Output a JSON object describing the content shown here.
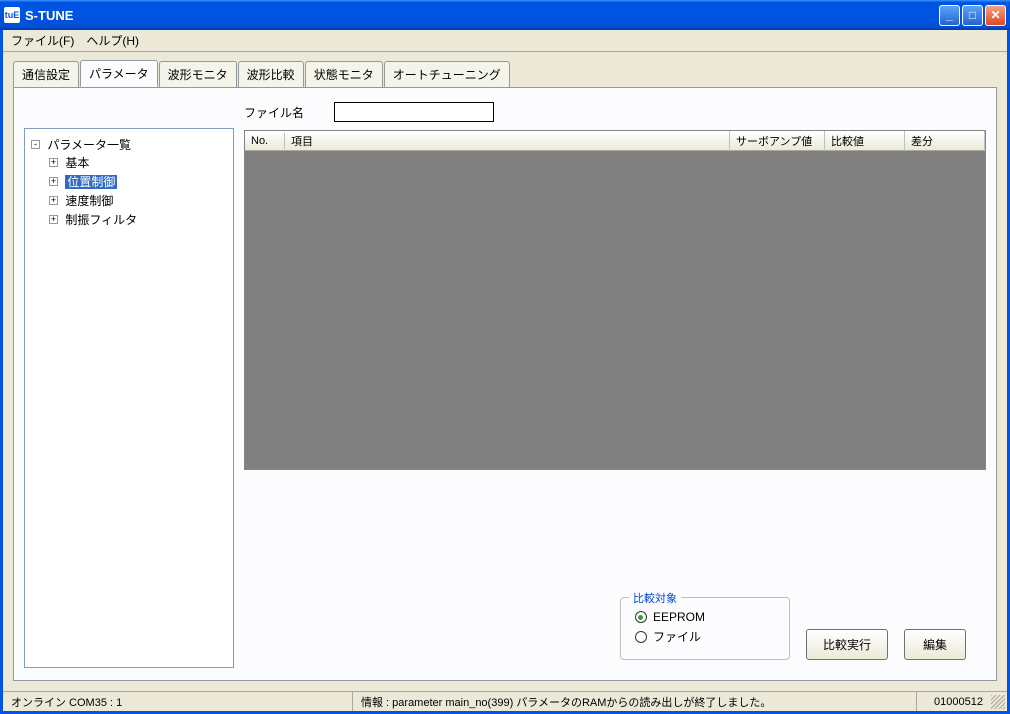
{
  "window": {
    "title": "S-TUNE",
    "icon_text": "tuE"
  },
  "menu": {
    "file": "ファイル(F)",
    "help": "ヘルプ(H)"
  },
  "tabs": [
    {
      "label": "通信設定",
      "active": false
    },
    {
      "label": "パラメータ",
      "active": true
    },
    {
      "label": "波形モニタ",
      "active": false
    },
    {
      "label": "波形比較",
      "active": false
    },
    {
      "label": "状態モニタ",
      "active": false
    },
    {
      "label": "オートチューニング",
      "active": false
    }
  ],
  "tree": {
    "root": "パラメータ一覧",
    "children": [
      {
        "label": "基本",
        "selected": false
      },
      {
        "label": "位置制御",
        "selected": true
      },
      {
        "label": "速度制御",
        "selected": false
      },
      {
        "label": "制振フィルタ",
        "selected": false
      }
    ]
  },
  "file_section": {
    "label": "ファイル名",
    "value": ""
  },
  "table_headers": {
    "no": "No.",
    "item": "項目",
    "amp": "サーボアンプ値",
    "cmp": "比較値",
    "diff": "差分"
  },
  "compare_group": {
    "title": "比較対象",
    "options": {
      "eeprom": "EEPROM",
      "file": "ファイル"
    },
    "selected": "eeprom"
  },
  "buttons": {
    "compare": "比較実行",
    "edit": "編集"
  },
  "statusbar": {
    "left": "オンライン COM35 : 1",
    "mid": "情報 : parameter main_no(399) パラメータのRAMからの読み出しが終了しました。",
    "right": "01000512"
  }
}
